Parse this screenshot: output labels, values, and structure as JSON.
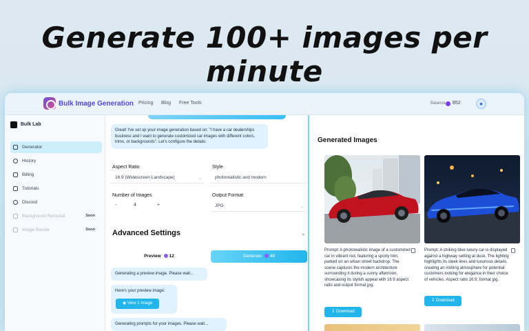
{
  "headline": "Generate 100+ images per minute",
  "app": {
    "brand": "Bulk Image Generation",
    "nav": [
      "Pricing",
      "Blog",
      "Free Tools"
    ],
    "balance_label": "Balance",
    "balance_value": "852"
  },
  "sidebar": {
    "workspace": "Bulk Lab",
    "items": [
      {
        "label": "Generator",
        "icon": "image-icon"
      },
      {
        "label": "History",
        "icon": "clock-icon"
      },
      {
        "label": "Billing",
        "icon": "credit-card-icon"
      },
      {
        "label": "Tutorials",
        "icon": "video-icon"
      },
      {
        "label": "Discord",
        "icon": "discord-icon"
      },
      {
        "label": "Background Removal",
        "icon": "scissors-icon",
        "badge": "Soon"
      },
      {
        "label": "Image Resize",
        "icon": "resize-icon",
        "badge": "Soon"
      }
    ]
  },
  "chat": {
    "intro": "Great! I've set up your image generation based on: \"I have a car dealerships business and I want to generate customized car images with different colors, trims, or backgrounds\". Let's configure the details:",
    "aspect_label": "Aspect Ratio",
    "aspect_value": "16:9 (Widescreen Landscape)",
    "style_label": "Style",
    "style_value": "photorealistic and modern",
    "num_label": "Number of Images",
    "num_minus": "-",
    "num_value": "4",
    "num_plus": "+",
    "format_label": "Output Format",
    "format_value": "JPG",
    "advanced": "Advanced Settings",
    "preview_label": "Preview",
    "preview_cost": "12",
    "generate_label": "Generate",
    "generate_cost": "48",
    "msg_generating_preview": "Generating a preview image. Please wait...",
    "msg_preview_ready": "Here's your preview image:",
    "view_button": "View 1 Image",
    "msg_generating_prompts": "Generating prompts for your images. Please wait..."
  },
  "results": {
    "title": "Generated Images",
    "cards": [
      {
        "prompt": "Prompt: A photorealistic image of a customized car in vibrant red, featuring a sporty trim, parked on an urban street backdrop. The scene captures the modern architecture surrounding it during a sunny afternoon, showcasing its stylish appeal with 16:9 aspect ratio and output format jpg.",
        "download": "Download"
      },
      {
        "prompt": "Prompt: A striking blue luxury car is displayed against a highway setting at dusk. The lighting highlights its sleek lines and luxurious details, creating an inviting atmosphere for potential customers looking for elegance in their choice of vehicles. Aspect ratio 16:9; format jpg.",
        "download": "Download"
      }
    ]
  },
  "colors": {
    "accent": "#22b5ec",
    "brand": "#4f46e5",
    "active_nav": "#cdeefb"
  }
}
